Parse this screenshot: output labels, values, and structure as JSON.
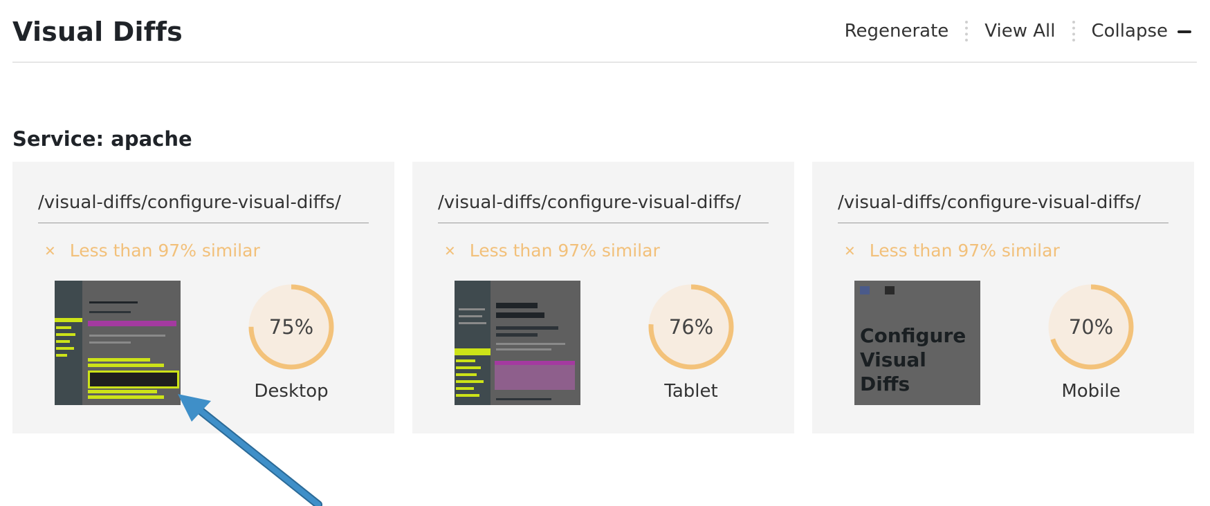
{
  "header": {
    "title": "Visual Diffs",
    "actions": {
      "regenerate": "Regenerate",
      "view_all": "View All",
      "collapse": "Collapse"
    }
  },
  "service": {
    "title": "Service: apache"
  },
  "cards": [
    {
      "path": "/visual-diffs/configure-visual-diffs/",
      "status_icon": "close-icon",
      "status": "Less than 97% similar",
      "similarity": 75,
      "similarity_label": "75%",
      "device": "Desktop"
    },
    {
      "path": "/visual-diffs/configure-visual-diffs/",
      "status_icon": "close-icon",
      "status": "Less than 97% similar",
      "similarity": 76,
      "similarity_label": "76%",
      "device": "Tablet"
    },
    {
      "path": "/visual-diffs/configure-visual-diffs/",
      "status_icon": "close-icon",
      "status": "Less than 97% similar",
      "similarity": 70,
      "similarity_label": "70%",
      "device": "Mobile"
    }
  ],
  "mobile_thumb_heading": "Configure Visual Diffs",
  "colors": {
    "warning": "#f2c07a",
    "gauge_track": "#f7ece0",
    "gauge_fill": "#f3c27a",
    "card_bg": "#f4f4f4",
    "highlight": "#cde318",
    "arrow": "#3f8fc8"
  }
}
